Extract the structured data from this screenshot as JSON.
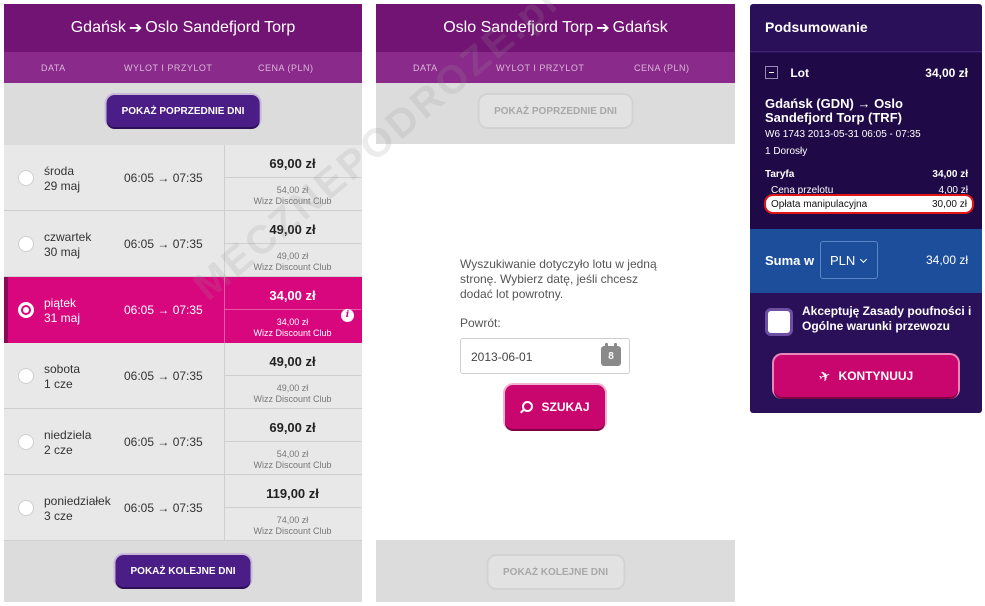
{
  "outbound": {
    "title_from": "Gdańsk",
    "title_to": "Oslo Sandefjord Torp",
    "arrow": "➔",
    "col_date": "DATA",
    "col_flight": "WYLOT I PRZYLOT",
    "col_price": "CENA (PLN)",
    "prev_label": "POKAŻ POPRZEDNIE DNI",
    "next_label": "POKAŻ KOLEJNE DNI",
    "rows": [
      {
        "day": "środa",
        "date": "29 maj",
        "time": "06:05 → 07:35",
        "price": "69,00 zł",
        "club_price": "54,00 zł",
        "club": "Wizz Discount Club"
      },
      {
        "day": "czwartek",
        "date": "30 maj",
        "time": "06:05 → 07:35",
        "price": "49,00 zł",
        "club_price": "49,00 zł",
        "club": "Wizz Discount Club"
      },
      {
        "day": "piątek",
        "date": "31 maj",
        "time": "06:05 → 07:35",
        "price": "34,00 zł",
        "club_price": "34,00 zł",
        "club": "Wizz Discount Club",
        "selected": true
      },
      {
        "day": "sobota",
        "date": "1 cze",
        "time": "06:05 → 07:35",
        "price": "49,00 zł",
        "club_price": "49,00 zł",
        "club": "Wizz Discount Club"
      },
      {
        "day": "niedziela",
        "date": "2 cze",
        "time": "06:05 → 07:35",
        "price": "69,00 zł",
        "club_price": "54,00 zł",
        "club": "Wizz Discount Club"
      },
      {
        "day": "poniedziałek",
        "date": "3 cze",
        "time": "06:05 → 07:35",
        "price": "119,00 zł",
        "club_price": "74,00 zł",
        "club": "Wizz Discount Club"
      }
    ]
  },
  "return": {
    "title_from": "Oslo Sandefjord Torp",
    "title_to": "Gdańsk",
    "arrow": "➔",
    "col_date": "DATA",
    "col_flight": "WYLOT I PRZYLOT",
    "col_price": "CENA (PLN)",
    "prev_label": "POKAŻ POPRZEDNIE DNI",
    "next_label": "POKAŻ KOLEJNE DNI",
    "message": "Wyszukiwanie dotyczyło lotu w jedną stronę. Wybierz datę, jeśli chcesz dodać lot powrotny.",
    "return_label": "Powrót:",
    "return_date": "2013-06-01",
    "calendar_day": "8",
    "search_label": "SZUKAJ"
  },
  "summary": {
    "title": "Podsumowanie",
    "lot_label": "Lot",
    "lot_amount": "34,00 zł",
    "route": "Gdańsk (GDN) → Oslo Sandefjord Torp (TRF)",
    "flight_info": "W6 1743  2013-05-31 06:05 - 07:35",
    "passengers": "1 Dorosły",
    "fare_label": "Taryfa",
    "fare_value": "34,00 zł",
    "flight_price_label": "Cena przelotu",
    "flight_price_value": "4,00 zł",
    "handling_label": "Opłata manipulacyjna",
    "handling_value": "30,00 zł",
    "total_label": "Suma w",
    "currency": "PLN",
    "total_value": "34,00 zł",
    "accept_text": "Akceptuję Zasady poufności i Ogólne warunki przewozu",
    "continue_label": "KONTYNUUJ"
  },
  "watermark": "MECZNEPODROZE.pl",
  "colors": {
    "header": "#721473",
    "selected": "#d8077e",
    "summary_bg": "#2a1058",
    "total_bar": "#1d4e9c",
    "highlight": "#e01616"
  }
}
